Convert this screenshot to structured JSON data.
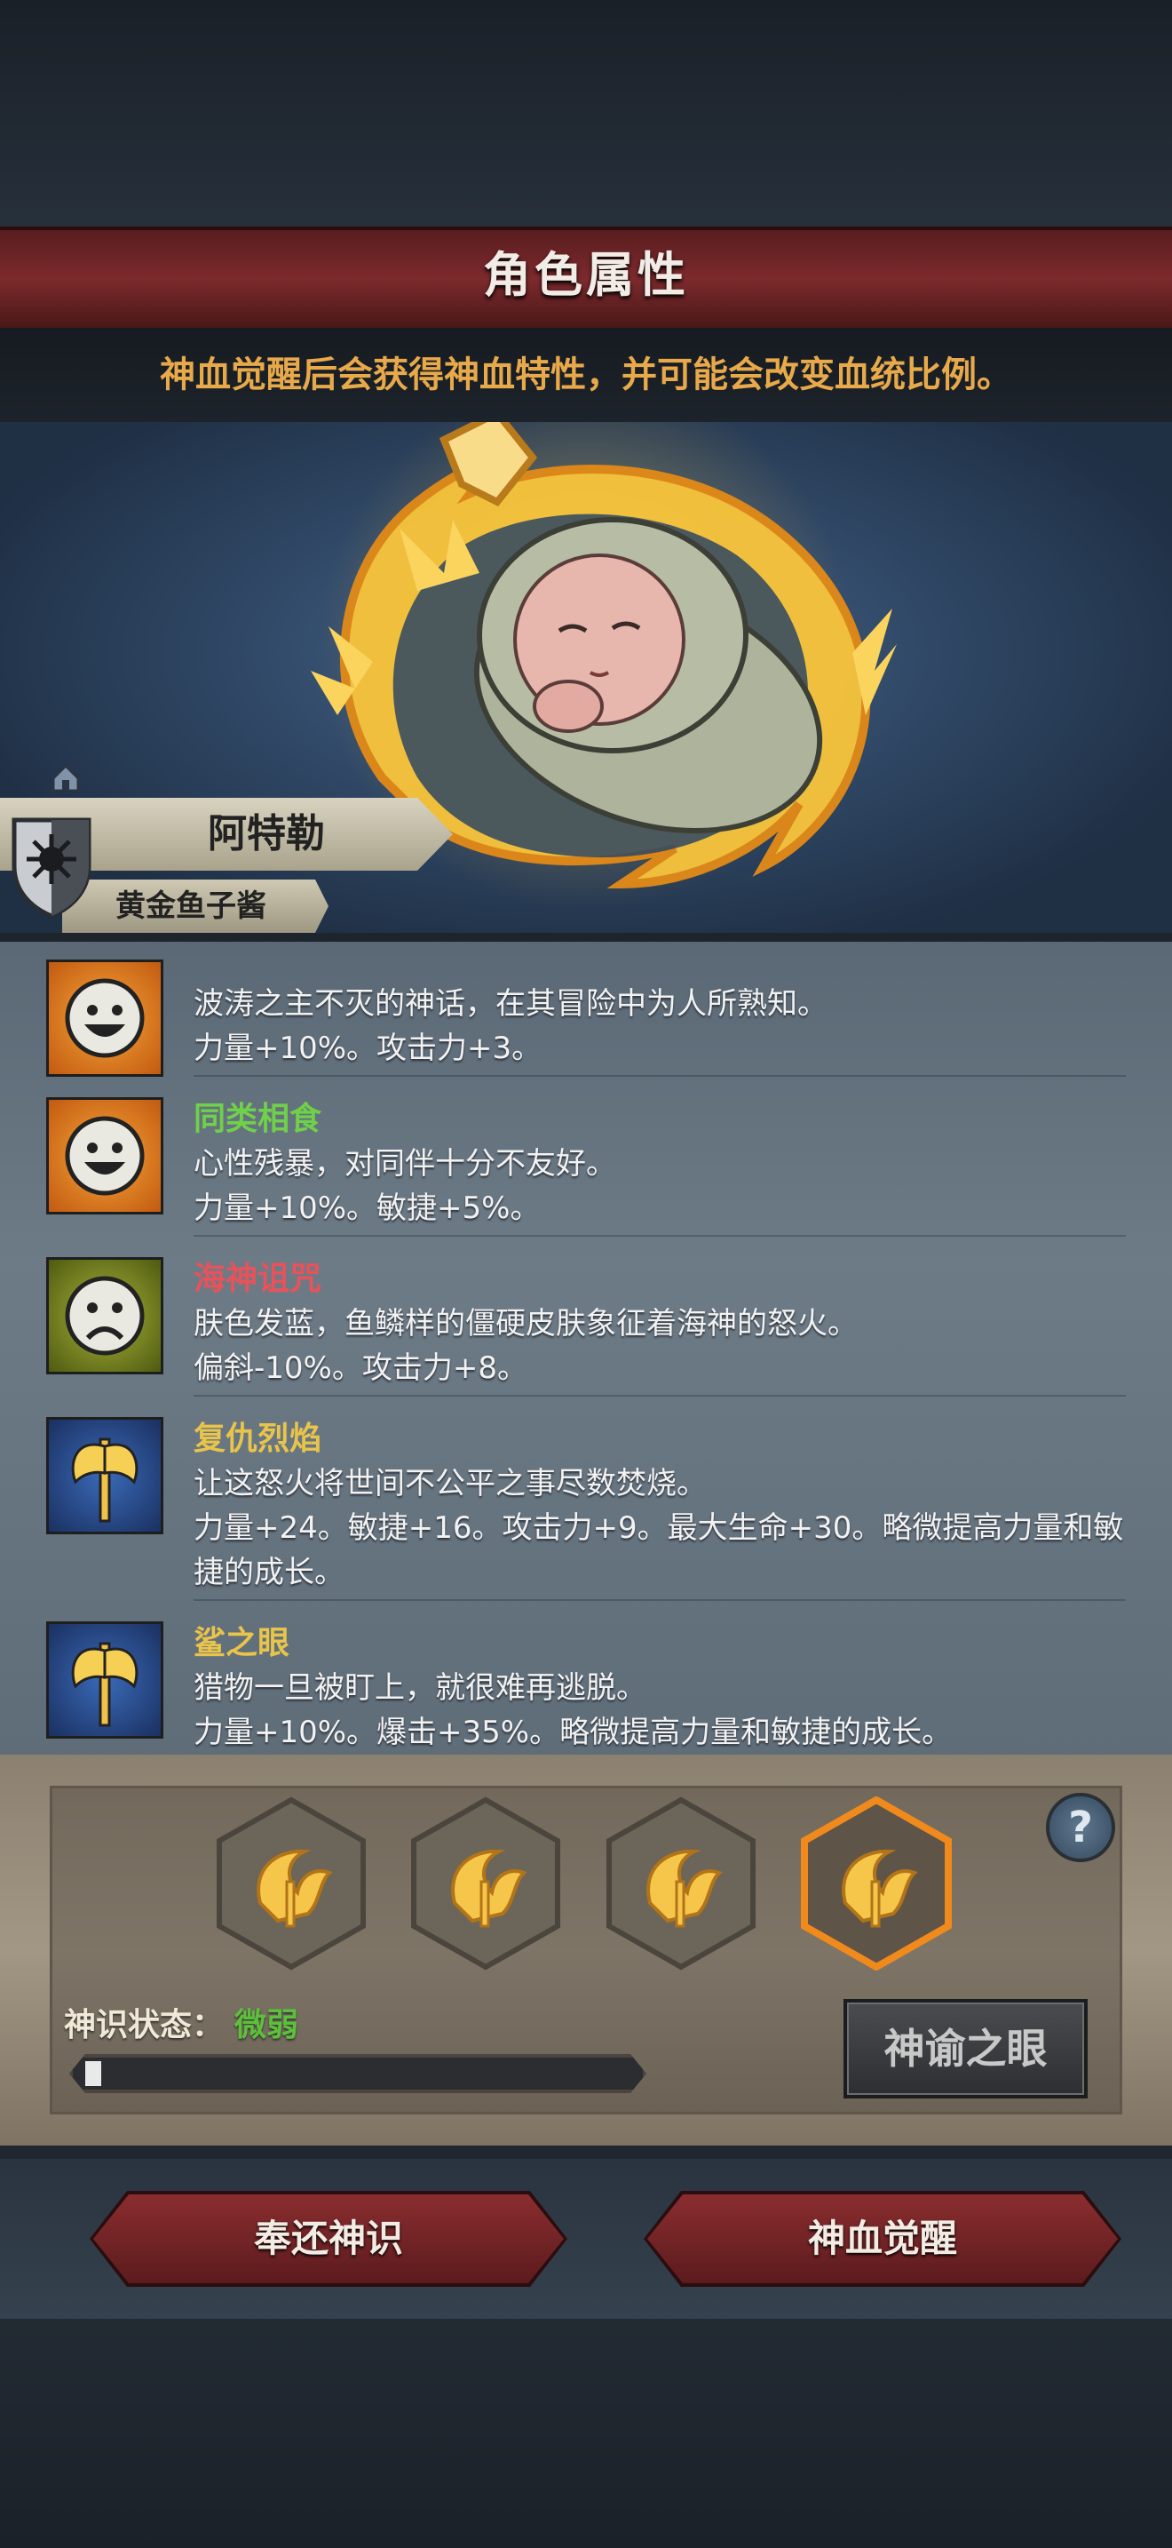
{
  "header": {
    "title": "角色属性",
    "subtitle": "神血觉醒后会获得神血特性，并可能会改变血统比例。"
  },
  "character": {
    "name": "阿特勒",
    "title": "黄金鱼子酱"
  },
  "traits": [
    {
      "name": "",
      "name_color": "#e8c44a",
      "icon": "smiley-happy-icon",
      "lines": [
        "波涛之主不灭的神话，在其冒险中为人所熟知。",
        "力量+10%。攻击力+3。"
      ]
    },
    {
      "name": "同类相食",
      "name_color": "#6fd04a",
      "icon": "smiley-happy-icon",
      "lines": [
        "心性残暴，对同伴十分不友好。",
        "力量+10%。敏捷+5%。"
      ]
    },
    {
      "name": "海神诅咒",
      "name_color": "#e8525a",
      "icon": "smiley-sad-icon",
      "lines": [
        "肤色发蓝，鱼鳞样的僵硬皮肤象征着海神的怒火。",
        "偏斜-10%。攻击力+8。"
      ]
    },
    {
      "name": "复仇烈焰",
      "name_color": "#e8c44a",
      "icon": "double-axe-icon",
      "lines": [
        "让这怒火将世间不公平之事尽数焚烧。",
        "力量+24。敏捷+16。攻击力+9。最大生命+30。略微提高力量和敏",
        "捷的成长。"
      ]
    },
    {
      "name": "鲨之眼",
      "name_color": "#e8c44a",
      "icon": "double-axe-icon",
      "lines": [
        "猎物一旦被盯上，就很难再逃脱。",
        "力量+10%。爆击+35%。略微提高力量和敏捷的成长。"
      ]
    }
  ],
  "god_panel": {
    "status_label": "神识状态：",
    "status_value": "微弱",
    "progress": 0.03,
    "oracle_button": "神谕之眼",
    "help": "?",
    "selected_slot": 4
  },
  "actions": {
    "return_label": "奉还神识",
    "awaken_label": "神血觉醒"
  },
  "colors": {
    "accent_red": "#7c2a2c",
    "subtitle_gold": "#e8a94a",
    "status_green": "#5dc03a",
    "hex_selected": "#f08a1c"
  }
}
